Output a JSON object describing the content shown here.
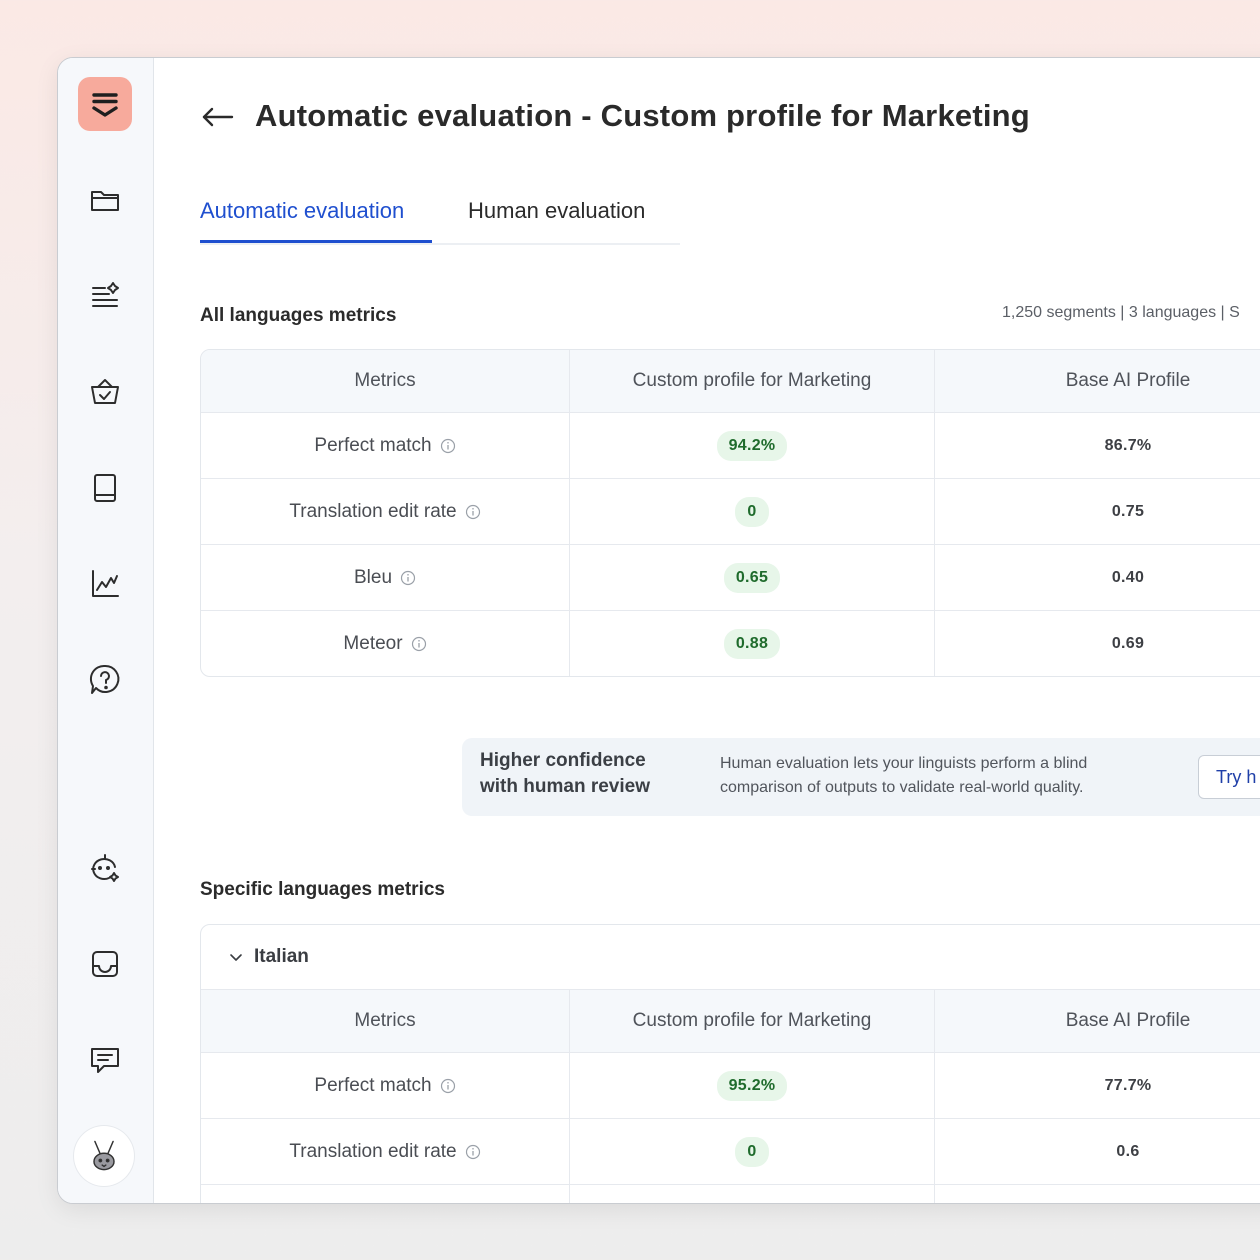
{
  "header": {
    "title": "Automatic evaluation - Custom profile for Marketing"
  },
  "tabs": [
    {
      "label": "Automatic evaluation",
      "active": true
    },
    {
      "label": "Human evaluation",
      "active": false
    }
  ],
  "sidebar": {
    "logo_icon": "logo-icon",
    "items": [
      {
        "icon": "folder-icon"
      },
      {
        "icon": "list-sparkle-icon"
      },
      {
        "icon": "basket-check-icon"
      },
      {
        "icon": "book-icon"
      },
      {
        "icon": "chart-line-icon"
      },
      {
        "icon": "help-icon"
      },
      {
        "icon": "ai-face-icon"
      },
      {
        "icon": "inbox-icon"
      },
      {
        "icon": "chat-icon"
      }
    ],
    "avatar_icon": "rabbit-avatar"
  },
  "all_languages": {
    "title": "All languages metrics",
    "summary": "1,250 segments | 3 languages | S",
    "columns": [
      "Metrics",
      "Custom profile for Marketing",
      "Base AI Profile"
    ],
    "rows": [
      {
        "metric": "Perfect match",
        "custom": "94.2%",
        "base": "86.7%"
      },
      {
        "metric": "Translation edit rate",
        "custom": "0",
        "base": "0.75"
      },
      {
        "metric": "Bleu",
        "custom": "0.65",
        "base": "0.40"
      },
      {
        "metric": "Meteor",
        "custom": "0.88",
        "base": "0.69"
      }
    ]
  },
  "banner": {
    "title": "Higher confidence with human review",
    "text": "Human evaluation lets your linguists perform a blind comparison of outputs to validate real-world quality.",
    "button": "Try h"
  },
  "specific_languages": {
    "title": "Specific languages metrics",
    "language": "Italian",
    "columns": [
      "Metrics",
      "Custom profile for Marketing",
      "Base AI Profile"
    ],
    "rows": [
      {
        "metric": "Perfect match",
        "custom": "95.2%",
        "base": "77.7%"
      },
      {
        "metric": "Translation edit rate",
        "custom": "0",
        "base": "0.6"
      }
    ]
  },
  "colors": {
    "accent": "#1f4fcf",
    "logo_bg": "#f7aa9c",
    "positive_pill_bg": "#e7f6e9",
    "positive_pill_text": "#1f6b2c"
  }
}
